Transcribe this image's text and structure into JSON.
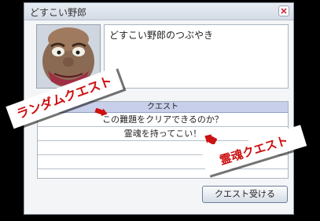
{
  "window": {
    "title": "どすこい野郎",
    "close_icon": "close-icon",
    "speech": "どすこい野郎のつぶやき"
  },
  "quest_list": {
    "header": "クエスト",
    "items": [
      "この難題をクリアできるのか？",
      "霊魂を持ってこい！",
      "",
      "",
      ""
    ]
  },
  "buttons": {
    "accept": "クエスト受ける"
  },
  "callouts": {
    "random": "ランダムクエスト",
    "spirit": "霊魂クエスト"
  },
  "colors": {
    "callout_text": "#cc1111",
    "header_bg": "#c7cfea",
    "background": "#000000"
  }
}
